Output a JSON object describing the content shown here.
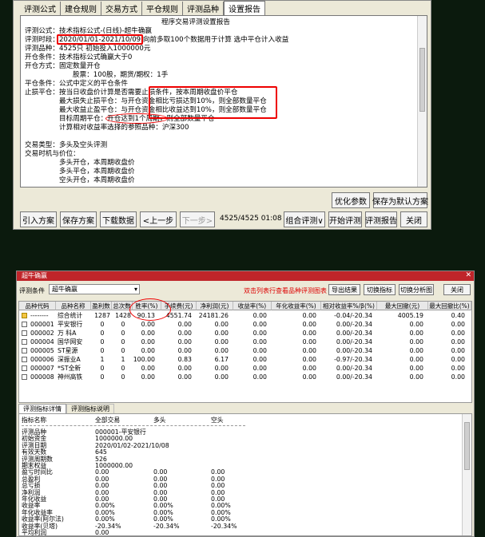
{
  "dialog1": {
    "tabs": [
      "评测公式",
      "建仓规则",
      "交易方式",
      "平仓规则",
      "评测品种",
      "设置报告"
    ],
    "report_lines": [
      "程序交易评测设置报告",
      "评测公式：技术指标公式-(日线)-超牛确赢",
      "评测时段：2020/01/01-2021/10/09 向前多取100个数据用于计算 选中平仓计入收益",
      "评测品种：4525只  初始投入1000000元",
      "开仓条件：技术指标公式确赢大于0",
      "开仓方式：固定数量开仓",
      "股票：100股，期货/期权：1手",
      "平仓条件：公式中定义的平仓条件",
      "止损平仓：按当日收盘价计算是否需要止损条件，按本周期收盘价平仓",
      "最大损失止损平仓：与开仓资金相比亏损达到10%，则全部数量平仓",
      "最大收益止盈平仓：与开仓资金相比收益达到10%，则全部数量平仓",
      "目标周期平仓：开仓达到1个周期，则全部数量平仓",
      "计算相对收益率选择的参照品种：沪深300",
      "",
      "交易类型：多头及空头评测",
      "交易时机与价位：",
      "多头开仓，本周期收盘价",
      "多头平仓，本周期收盘价",
      "空头开仓，本周期收盘价"
    ],
    "buttons": {
      "optimize": "优化参数",
      "save_default": "保存为默认方案",
      "import": "引入方案",
      "save": "保存方案",
      "download": "下载数据",
      "prev": "<上一步",
      "next": "下一步>",
      "progress": "4525/4525 01:08",
      "combined": "组合评测∨",
      "start": "开始评测",
      "report": "评测报告",
      "close": "关闭"
    }
  },
  "dialog2": {
    "title": "超牛确赢",
    "condition_label": "评测条件",
    "condition_value": "超牛确赢",
    "hint": "双击列表行查看品种评测图表",
    "buttons": {
      "export": "导出结果",
      "switch": "切换指标",
      "switch_chart": "切换分析图",
      "close": "关闭"
    },
    "columns": [
      "品种代码",
      "品种名称",
      "盈利数",
      "总次数",
      "胜率(%)",
      "手续费(元)",
      "净利润(元)",
      "收益率(%)",
      "年化收益率(%)",
      "相对收益率%/β(%)",
      "最大回撤(元)",
      "最大回撤比(%)"
    ],
    "rows": [
      [
        "--------",
        "综合统计",
        "1287",
        "1428",
        "90.13",
        "4551.74",
        "24181.26",
        "0.00",
        "0.00",
        "-0.04/-20.34",
        "4005.19",
        "0.40"
      ],
      [
        "000001",
        "平安银行",
        "0",
        "0",
        "0.00",
        "0.00",
        "0.00",
        "0.00",
        "0.00",
        "0.00/-20.34",
        "0.00",
        "0.00"
      ],
      [
        "000002",
        "万 科A",
        "0",
        "0",
        "0.00",
        "0.00",
        "0.00",
        "0.00",
        "0.00",
        "0.00/-20.34",
        "0.00",
        "0.00"
      ],
      [
        "000004",
        "国华网安",
        "0",
        "0",
        "0.00",
        "0.00",
        "0.00",
        "0.00",
        "0.00",
        "0.00/-20.34",
        "0.00",
        "0.00"
      ],
      [
        "000005",
        "ST星源",
        "0",
        "0",
        "0.00",
        "0.00",
        "0.00",
        "0.00",
        "0.00",
        "0.00/-20.34",
        "0.00",
        "0.00"
      ],
      [
        "000006",
        "深振业A",
        "1",
        "1",
        "100.00",
        "0.83",
        "6.17",
        "0.00",
        "0.00",
        "-0.97/-20.34",
        "0.00",
        "0.00"
      ],
      [
        "000007",
        "*ST全新",
        "0",
        "0",
        "0.00",
        "0.00",
        "0.00",
        "0.00",
        "0.00",
        "0.00/-20.34",
        "0.00",
        "0.00"
      ],
      [
        "000008",
        "神州高铁",
        "0",
        "0",
        "0.00",
        "0.00",
        "0.00",
        "0.00",
        "0.00",
        "0.00/-20.34",
        "0.00",
        "0.00"
      ]
    ],
    "lower_tabs": [
      "评测指标详情",
      "评测指标说明"
    ],
    "lower_headers": [
      "指标名称",
      "全部交易",
      "多头",
      "空头"
    ],
    "lower_rows": [
      [
        "评测品种",
        "000001-平安银行",
        "",
        ""
      ],
      [
        "初始资金",
        "1000000.00",
        "",
        ""
      ],
      [
        "评测日期",
        "2020/01/02-2021/10/08",
        "",
        ""
      ],
      [
        "有效天数",
        "645",
        "",
        ""
      ],
      [
        "评测周期数",
        "526",
        "",
        ""
      ],
      [
        "期末权益",
        "1000000.00",
        "",
        ""
      ],
      [
        "盈亏时间比",
        "0.00",
        "0.00",
        "0.00"
      ],
      [
        "总盈利",
        "0.00",
        "0.00",
        "0.00"
      ],
      [
        "总亏损",
        "0.00",
        "0.00",
        "0.00"
      ],
      [
        "净利润",
        "0.00",
        "0.00",
        "0.00"
      ],
      [
        "年化收益",
        "0.00",
        "0.00",
        "0.00"
      ],
      [
        "收益率",
        "0.00%",
        "0.00%",
        "0.00%"
      ],
      [
        "年化收益率",
        "0.00%",
        "0.00%",
        "0.00%"
      ],
      [
        "收益率(阿尔法)",
        "0.00%",
        "0.00%",
        "0.00%"
      ],
      [
        "收益率(贝塔)",
        "-20.34%",
        "-20.34%",
        "-20.34%"
      ],
      [
        "平均利润",
        "0.00",
        "",
        ""
      ]
    ]
  }
}
